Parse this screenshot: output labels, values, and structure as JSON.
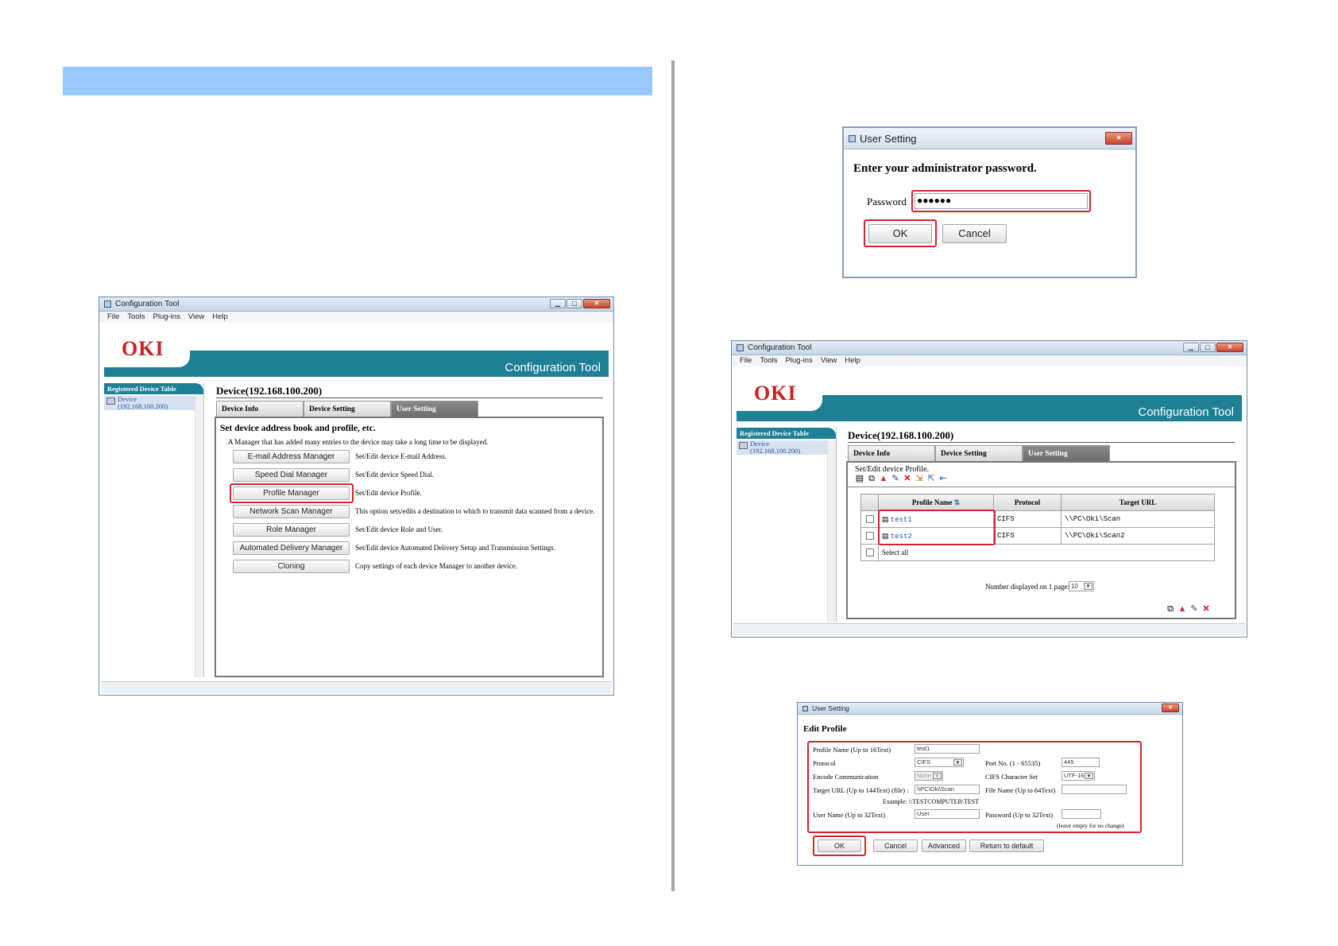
{
  "window_main": {
    "title": "Configuration Tool",
    "menu": [
      "File",
      "Tools",
      "Plug-ins",
      "View",
      "Help"
    ],
    "logo": "OKI",
    "banner": "Configuration Tool",
    "sidebar_header": "Registered Device Table",
    "sidebar_device": "Device",
    "sidebar_device_ip": "(192.168.100.200)",
    "device_title": "Device(192.168.100.200)",
    "tabs": [
      "Device Info",
      "Device Setting",
      "User Setting"
    ],
    "panel_heading": "Set device address book and profile, etc.",
    "panel_note": "A Manager that has added many entries to the device may take a long time to be displayed.",
    "managers": [
      {
        "label": "E-mail Address Manager",
        "desc": "Set/Edit device E-mail Address."
      },
      {
        "label": "Speed Dial Manager",
        "desc": "Set/Edit device Speed Dial."
      },
      {
        "label": "Profile Manager",
        "desc": "Set/Edit device Profile."
      },
      {
        "label": "Network Scan Manager",
        "desc": "This option sets/edits a destination to which to transmit data scanned from a device."
      },
      {
        "label": "Role Manager",
        "desc": "Set/Edit device Role and User."
      },
      {
        "label": "Automated Delivery Manager",
        "desc": "Set/Edit device Automated Delivery Setup and Transmission Settings."
      },
      {
        "label": "Cloning",
        "desc": "Copy settings of each device Manager to another device."
      }
    ]
  },
  "dialog_password": {
    "title": "User Setting",
    "heading": "Enter your administrator password.",
    "password_label": "Password",
    "password_value": "●●●●●●",
    "ok": "OK",
    "cancel": "Cancel"
  },
  "window_profile": {
    "title": "Configuration Tool",
    "menu": [
      "File",
      "Tools",
      "Plug-ins",
      "View",
      "Help"
    ],
    "logo": "OKI",
    "banner": "Configuration Tool",
    "sidebar_header": "Registered Device Table",
    "sidebar_device": "Device",
    "sidebar_device_ip": "(192.168.100.200)",
    "device_title": "Device(192.168.100.200)",
    "tabs": [
      "Device Info",
      "Device Setting",
      "User Setting"
    ],
    "panel_heading": "Set/Edit device Profile.",
    "columns": [
      "Profile Name",
      "Protocol",
      "Target URL"
    ],
    "rows": [
      {
        "name": "test1",
        "protocol": "CIFS",
        "url": "\\\\PC\\Oki\\Scan"
      },
      {
        "name": "test2",
        "protocol": "CIFS",
        "url": "\\\\PC\\Oki\\Scan2"
      }
    ],
    "select_all": "Select all",
    "per_page_label": "Number displayed on 1 page:",
    "per_page_value": "10"
  },
  "dialog_edit": {
    "title": "User Setting",
    "heading": "Edit Profile",
    "labels": {
      "profile_name": "Profile Name (Up to 16Text)",
      "protocol": "Protocol",
      "encode": "Encode Communication",
      "target_url": "Target URL (Up to 144Text) (file) :",
      "example_label": "Example:",
      "example_value": "\\\\TESTCOMPUTER\\TEST",
      "user_name": "User Name (Up to 32Text)",
      "port_no": "Port No. (1 - 65535)",
      "cifs_charset": "CIFS Character Set",
      "file_name": "File Name (Up to 64Text)",
      "password": "Password (Up to 32Text)",
      "leave_empty": "(leave empty for no change)"
    },
    "values": {
      "profile_name": "test1",
      "protocol": "CIFS",
      "encode": "None",
      "target_url": "\\\\PC\\Oki\\Scan",
      "user_name": "User",
      "port_no": "445",
      "cifs_charset": "UTF-16",
      "file_name": "",
      "password": ""
    },
    "buttons": {
      "ok": "OK",
      "cancel": "Cancel",
      "advanced": "Advanced",
      "return_default": "Return to default"
    }
  },
  "colors": {
    "highlight_red": "#d4242b",
    "oki_red": "#cf1f1f",
    "banner_teal": "#1e7f95",
    "header_bar_blue": "#99c7ff"
  }
}
